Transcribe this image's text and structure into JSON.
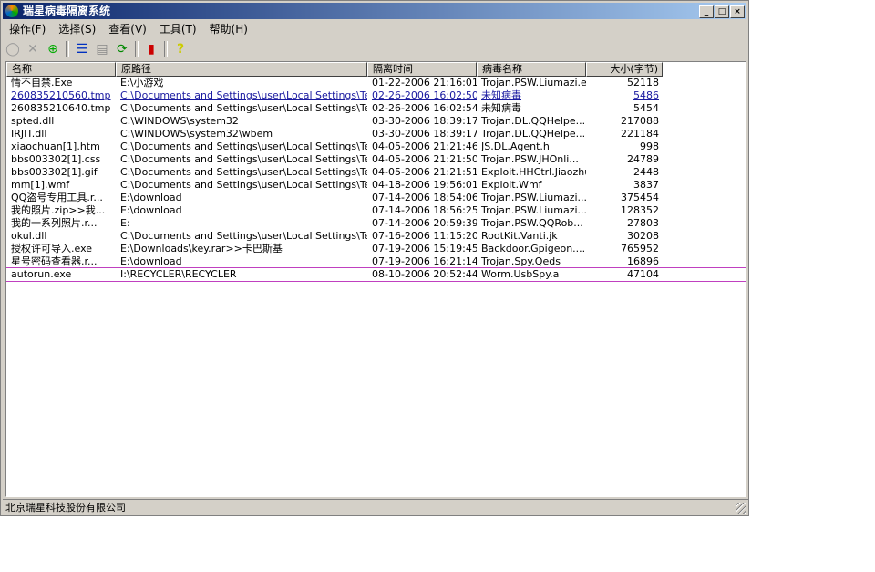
{
  "title": "瑞星病毒隔离系统",
  "menu": [
    "操作(F)",
    "选择(S)",
    "查看(V)",
    "工具(T)",
    "帮助(H)"
  ],
  "toolbar_icons": [
    "restore-icon",
    "delete-icon",
    "add-icon",
    "details-view-icon",
    "list-view-icon",
    "refresh-icon",
    "chart-icon",
    "help-icon"
  ],
  "columns": [
    "名称",
    "原路径",
    "隔离时间",
    "病毒名称",
    "大小(字节)"
  ],
  "rows": [
    [
      "情不自禁.Exe",
      "E:\\小游戏",
      "01-22-2006 21:16:01",
      "Trojan.PSW.Liumazi.e",
      "52118"
    ],
    [
      "260835210560.tmp",
      "C:\\Documents and Settings\\user\\Local Settings\\Temp",
      "02-26-2006 16:02:50",
      "未知病毒",
      "5486"
    ],
    [
      "260835210640.tmp",
      "C:\\Documents and Settings\\user\\Local Settings\\Temp",
      "02-26-2006 16:02:54",
      "未知病毒",
      "5454"
    ],
    [
      "spted.dll",
      "C:\\WINDOWS\\system32",
      "03-30-2006 18:39:17",
      "Trojan.DL.QQHelpe...",
      "217088"
    ],
    [
      "IRJIT.dll",
      "C:\\WINDOWS\\system32\\wbem",
      "03-30-2006 18:39:17",
      "Trojan.DL.QQHelpe...",
      "221184"
    ],
    [
      "xiaochuan[1].htm",
      "C:\\Documents and Settings\\user\\Local Settings\\Tem...",
      "04-05-2006 21:21:46",
      "JS.DL.Agent.h",
      "998"
    ],
    [
      "bbs003302[1].css",
      "C:\\Documents and Settings\\user\\Local Settings\\Tem...",
      "04-05-2006 21:21:50",
      "Trojan.PSW.JHOnli...",
      "24789"
    ],
    [
      "bbs003302[1].gif",
      "C:\\Documents and Settings\\user\\Local Settings\\Tem...",
      "04-05-2006 21:21:51",
      "Exploit.HHCtrl.Jiaozhu",
      "2448"
    ],
    [
      "mm[1].wmf",
      "C:\\Documents and Settings\\user\\Local Settings\\Tem...",
      "04-18-2006 19:56:01",
      "Exploit.Wmf",
      "3837"
    ],
    [
      "QQ盗号专用工具.r...",
      "E:\\download",
      "07-14-2006 18:54:06",
      "Trojan.PSW.Liumazi...",
      "375454"
    ],
    [
      "我的照片.zip>>我...",
      "E:\\download",
      "07-14-2006 18:56:25",
      "Trojan.PSW.Liumazi...",
      "128352"
    ],
    [
      "我的一系列照片.r...",
      "E:",
      "07-14-2006 20:59:39",
      "Trojan.PSW.QQRob...",
      "27803"
    ],
    [
      "okul.dll",
      "C:\\Documents and Settings\\user\\Local Settings\\Temp",
      "07-16-2006 11:15:20",
      "RootKit.Vanti.jk",
      "30208"
    ],
    [
      "授权许可导入.exe",
      "E:\\Downloads\\key.rar>>卡巴斯基",
      "07-19-2006 15:19:45",
      "Backdoor.Gpigeon....",
      "765952"
    ],
    [
      "星号密码查看器.r...",
      "E:\\download",
      "07-19-2006 16:21:14",
      "Trojan.Spy.Qeds",
      "16896"
    ],
    [
      "autorun.exe",
      "I:\\RECYCLER\\RECYCLER",
      "08-10-2006 20:52:44",
      "Worm.UsbSpy.a",
      "47104"
    ]
  ],
  "status": "北京瑞星科技股份有限公司"
}
